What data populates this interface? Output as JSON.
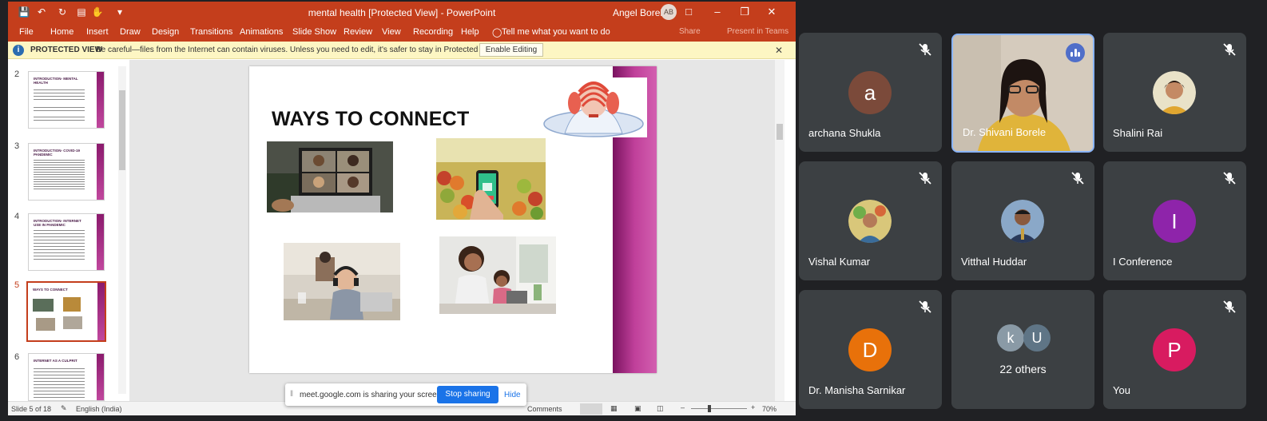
{
  "powerpoint": {
    "title": "mental health [Protected View]  -  PowerPoint",
    "user": "Angel Borele",
    "user_initials": "AB",
    "tabs": [
      "File",
      "Home",
      "Insert",
      "Draw",
      "Design",
      "Transitions",
      "Animations",
      "Slide Show",
      "Review",
      "View",
      "Recording",
      "Help"
    ],
    "tell_me": "Tell me what you want to do",
    "share": "Share",
    "present_teams": "Present in Teams",
    "protected_view": {
      "title": "PROTECTED VIEW",
      "message": "Be careful—files from the Internet can contain viruses. Unless you need to edit, it's safer to stay in Protected View.",
      "button": "Enable Editing"
    },
    "thumbnails": [
      {
        "num": "2",
        "title": "INTRODUCTION- MENTAL HEALTH"
      },
      {
        "num": "3",
        "title": "INTRODUCTION- COVID-19 PANDEMIC"
      },
      {
        "num": "4",
        "title": "INTRODUCTION- INTERNET USE IN PANDEMIC"
      },
      {
        "num": "5",
        "title": "WAYS TO CONNECT"
      },
      {
        "num": "6",
        "title": "INTERNET AS A CULPRIT"
      }
    ],
    "slide_title": "WAYS TO CONNECT",
    "status": {
      "slide": "Slide 5 of 18",
      "language": "English (India)",
      "comments": "Comments",
      "zoom": "70%"
    }
  },
  "sharebar": {
    "message": "meet.google.com is sharing your screen.",
    "stop": "Stop sharing",
    "hide": "Hide"
  },
  "participants": [
    {
      "name": "archana Shukla",
      "initial": "a",
      "color": "#7b4a3a"
    },
    {
      "name": "Dr. Shivani Borele",
      "speaking": true
    },
    {
      "name": "Shalini Rai"
    },
    {
      "name": "Vishal Kumar"
    },
    {
      "name": "Vitthal Huddar"
    },
    {
      "name": "I Conference",
      "initial": "I",
      "color": "#8e24aa"
    },
    {
      "name": "Dr. Manisha Sarnikar",
      "initial": "D",
      "color": "#e8710a"
    },
    {
      "name": "22 others",
      "initials": [
        "k",
        "U"
      ]
    },
    {
      "name": "You",
      "initial": "P",
      "color": "#d81b60"
    }
  ]
}
